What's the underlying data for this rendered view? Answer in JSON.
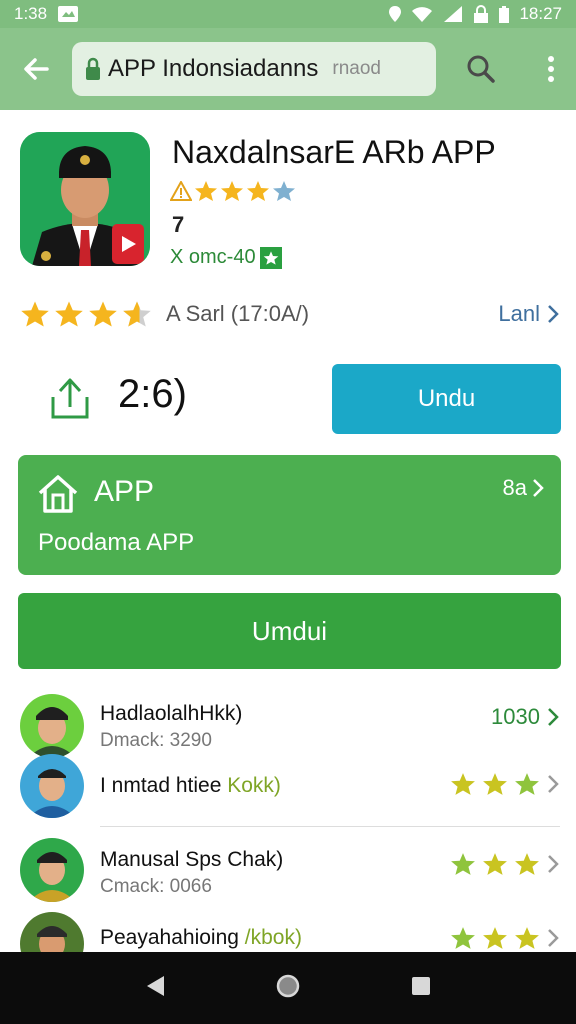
{
  "status_bar": {
    "time": "1:38",
    "battery_text": "18:27"
  },
  "address_bar": {
    "url": "APP Indonsiadanns",
    "url_suffix": "rnaod"
  },
  "app": {
    "title": "NaxdalnsarE ARb APP",
    "age_rating": "7",
    "install_tag": "X omc-40",
    "rating_text": "A Sarl (17:0A/)",
    "more_link": "Lanl",
    "share_count": "2:6)",
    "install_button": "Undu"
  },
  "card": {
    "title": "APP",
    "subtitle": "Poodama APP",
    "count": "8a"
  },
  "big_button": {
    "label": "Umdui"
  },
  "list": [
    {
      "name": "Hadlaola",
      "name_tail": "lhHkk)",
      "sub": "Dmack: 3290",
      "right": "1030"
    },
    {
      "name": "I nmtad htiee",
      "name_tail": "Kokk)",
      "sub": "",
      "right": ""
    },
    {
      "name": "Manusal Sps Chak)",
      "name_tail": "",
      "sub": "Cmack: 0066",
      "right": ""
    },
    {
      "name": "Peayahahioing",
      "name_tail": "/kbok)",
      "sub": "",
      "right": ""
    }
  ],
  "colors": {
    "status_bar": "#7fbd7f",
    "app_bar": "#8bc48b",
    "install_button": "#1ba8c8",
    "card": "#4caf50",
    "big_button": "#36a33f",
    "star": "#f5b51e"
  }
}
